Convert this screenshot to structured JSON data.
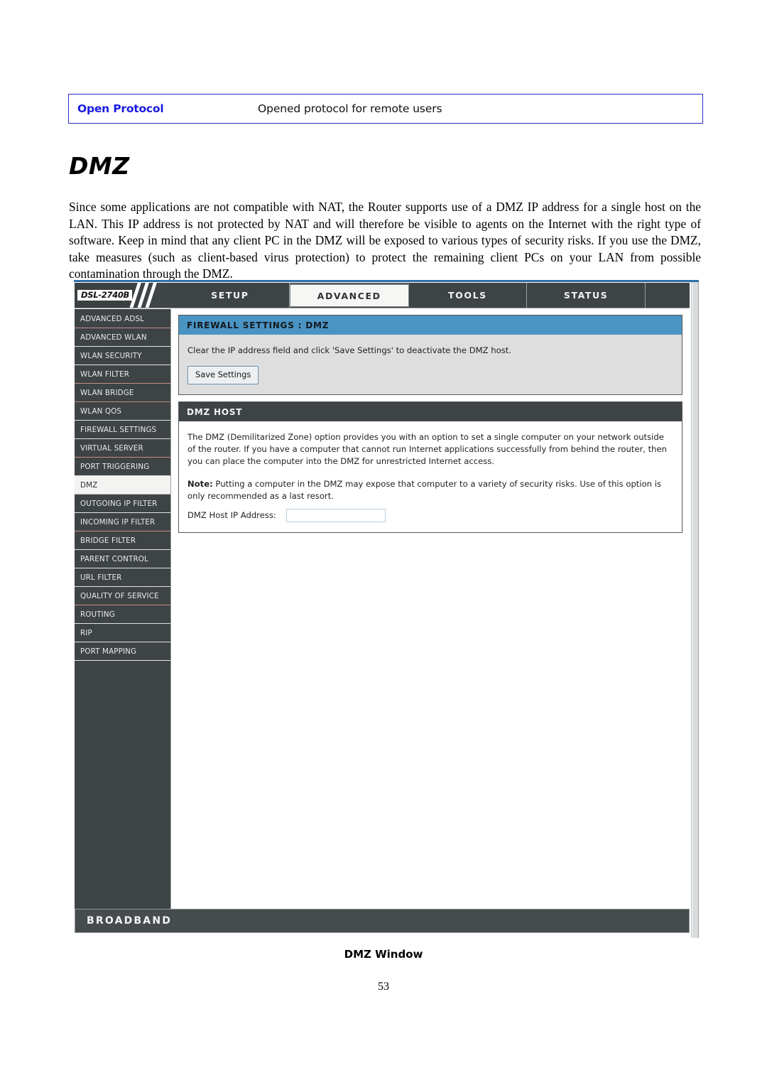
{
  "document": {
    "glossary_row": {
      "term": "Open Protocol",
      "description": "Opened protocol for remote users"
    },
    "heading": "DMZ",
    "paragraph": "Since some applications are not compatible with NAT, the Router supports use of a DMZ IP address for a single host on the LAN. This IP address is not protected by NAT and will therefore be visible to agents on the Internet with the right type of software. Keep in mind that any client PC in the DMZ will be exposed to various types of security risks. If you use the DMZ, take measures (such as client-based virus protection) to protect the remaining client PCs on your LAN from possible contamination through the DMZ.",
    "figure_caption": "DMZ Window",
    "page_number": "53"
  },
  "router_ui": {
    "brand": {
      "model": "DSL-2740B"
    },
    "nav_tabs": [
      {
        "label": "SETUP",
        "active": false
      },
      {
        "label": "ADVANCED",
        "active": true
      },
      {
        "label": "TOOLS",
        "active": false
      },
      {
        "label": "STATUS",
        "active": false
      }
    ],
    "sidebar": {
      "items": [
        {
          "label": "ADVANCED ADSL",
          "active": false
        },
        {
          "label": "ADVANCED WLAN",
          "active": false
        },
        {
          "label": "WLAN SECURITY",
          "active": false
        },
        {
          "label": "WLAN FILTER",
          "active": false
        },
        {
          "label": "WLAN BRIDGE",
          "active": false
        },
        {
          "label": "WLAN QOS",
          "active": false
        },
        {
          "label": "FIREWALL SETTINGS",
          "active": false
        },
        {
          "label": "VIRTUAL SERVER",
          "active": false
        },
        {
          "label": "PORT TRIGGERING",
          "active": false
        },
        {
          "label": "DMZ",
          "active": true
        },
        {
          "label": "OUTGOING IP FILTER",
          "active": false
        },
        {
          "label": "INCOMING IP FILTER",
          "active": false
        },
        {
          "label": "BRIDGE FILTER",
          "active": false
        },
        {
          "label": "PARENT CONTROL",
          "active": false
        },
        {
          "label": "URL FILTER",
          "active": false
        },
        {
          "label": "QUALITY OF SERVICE",
          "active": false
        },
        {
          "label": "ROUTING",
          "active": false
        },
        {
          "label": "RIP",
          "active": false
        },
        {
          "label": "PORT MAPPING",
          "active": false
        }
      ]
    },
    "panels": {
      "firewall": {
        "title": "FIREWALL SETTINGS : DMZ",
        "instruction": "Clear the IP address field and click 'Save Settings' to deactivate the DMZ host.",
        "save_button": "Save Settings"
      },
      "dmz_host": {
        "title": "DMZ HOST",
        "description": "The DMZ (Demilitarized Zone) option provides you with an option to set a single computer on your network outside of the router. If you have a computer that cannot run Internet applications successfully from behind the router, then you can place the computer into the DMZ for unrestricted Internet access.",
        "note_label": "Note:",
        "note_text": " Putting a computer in the DMZ may expose that computer to a variety of security risks. Use of this option is only recommended as a last resort.",
        "field_label": "DMZ Host IP Address:",
        "field_value": "",
        "field_placeholder": ""
      }
    },
    "footer": {
      "text": "BROADBAND"
    },
    "colors": {
      "nav_dark": "#3e4345",
      "panel_blue": "#4a94c4",
      "panel_gray": "#dedede",
      "accent_blue_doc": "#1a1ae0"
    }
  }
}
